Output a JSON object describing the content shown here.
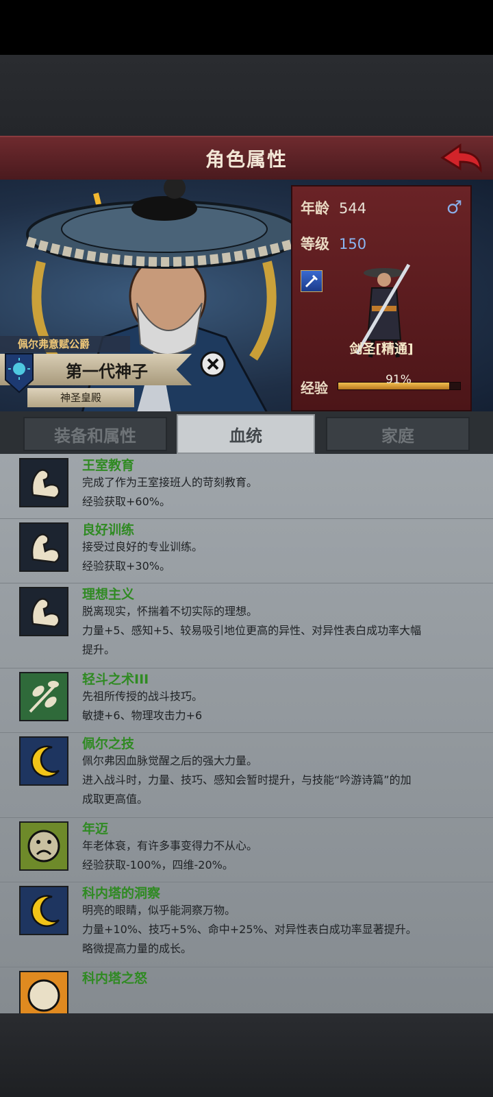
{
  "header": {
    "title": "角色属性"
  },
  "hero": {
    "dynasty": "佩尔弗意赋公爵",
    "title": "第一代神子",
    "realm": "神圣皇殿"
  },
  "stats": {
    "age_label": "年龄",
    "age": "544",
    "level_label": "等级",
    "level": "150",
    "class_name": "剑圣[精通]",
    "exp_label": "经验",
    "exp_text": "91%",
    "exp_fraction": 0.91,
    "gender_icon": "male-icon"
  },
  "tabs": [
    {
      "label": "装备和属性"
    },
    {
      "label": "血统"
    },
    {
      "label": "家庭"
    }
  ],
  "active_tab": 1,
  "traits": [
    {
      "name": "王室教育",
      "icon": "arm-icon",
      "lines": [
        "完成了作为王室接班人的苛刻教育。",
        "经验获取+60%。"
      ]
    },
    {
      "name": "良好训练",
      "icon": "arm-icon",
      "lines": [
        "接受过良好的专业训练。",
        "经验获取+30%。"
      ]
    },
    {
      "name": "理想主义",
      "icon": "arm-icon",
      "lines": [
        "脱离现实，怀揣着不切实际的理想。",
        "力量+5、感知+5、较易吸引地位更高的异性、对异性表白成功率大幅",
        "提升。"
      ]
    },
    {
      "name": "轻斗之术III",
      "icon": "leaf-icon",
      "lines": [
        "先祖所传授的战斗技巧。",
        "敏捷+6、物理攻击力+6"
      ]
    },
    {
      "name": "佩尔之技",
      "icon": "moon-icon",
      "lines": [
        "佩尔弗因血脉觉醒之后的强大力量。",
        "进入战斗时，力量、技巧、感知会暂时提升，与技能“吟游诗篇”的加",
        "成取更高值。"
      ]
    },
    {
      "name": "年迈",
      "icon": "sad-face-icon",
      "lines": [
        "年老体衰，有许多事变得力不从心。",
        "经验获取-100%，四维-20%。"
      ]
    },
    {
      "name": "科内塔的洞察",
      "icon": "moon-icon",
      "lines": [
        "明亮的眼睛，似乎能洞察万物。",
        "力量+10%、技巧+5%、命中+25%、对异性表白成功率显著提升。",
        "略微提高力量的成长。"
      ]
    },
    {
      "name": "科内塔之怒",
      "icon": "face-icon",
      "lines": []
    }
  ]
}
